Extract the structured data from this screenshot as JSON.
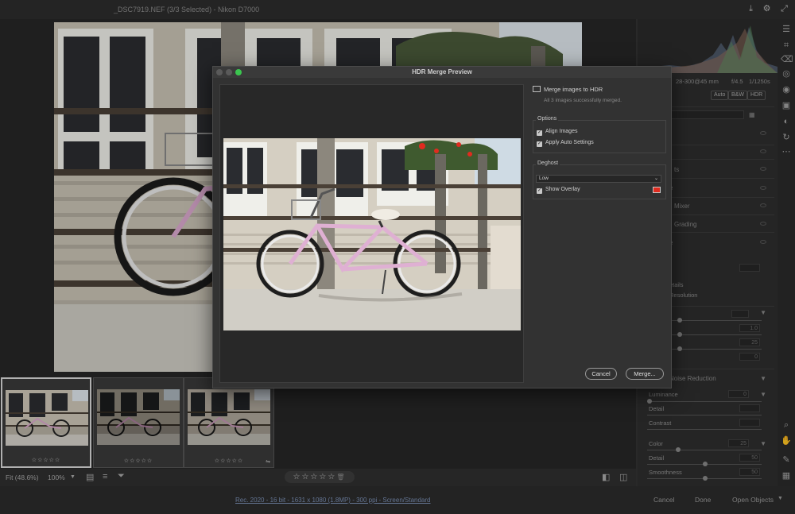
{
  "window": {
    "title": "_DSC7919.NEF (3/3 Selected)  -  Nikon D7000"
  },
  "right_panel": {
    "camera_info": [
      "28-300@45 mm",
      "f/4.5",
      "1/1250s"
    ],
    "profile_buttons": [
      "Auto",
      "B&W",
      "HDR"
    ],
    "sections": [
      "ts",
      "e",
      "Mixer",
      "Grading",
      "e",
      "etails",
      "Resolution",
      "Noise Reduction"
    ],
    "values": [
      "1.0",
      "25",
      "0"
    ],
    "noise": {
      "luminance_label": "Luminance",
      "luminance_value": "0",
      "detail_label": "Detail",
      "contrast_label": "Contrast",
      "color_label": "Color",
      "color_value": "25",
      "color_detail_label": "Detail",
      "color_detail_value": "50",
      "smoothness_label": "Smoothness",
      "smoothness_value": "50"
    }
  },
  "filmstrip": {
    "thumbs": [
      {
        "stars": "☆☆☆☆☆",
        "selected": true
      },
      {
        "stars": "☆☆☆☆☆",
        "selected": false
      },
      {
        "stars": "☆☆☆☆☆",
        "selected": false
      }
    ]
  },
  "bottombar": {
    "fit": "Fit (48.6%)",
    "zoom": "100%",
    "rating": "☆☆☆☆☆"
  },
  "status": {
    "info": "Rec. 2020 - 16 bit - 1631 x 1080 (1.8MP) - 300 ppi - Screen/Standard",
    "cancel": "Cancel",
    "done": "Done",
    "open": "Open Objects"
  },
  "dialog": {
    "title": "HDR Merge Preview",
    "merge_title": "Merge images to HDR",
    "merge_sub": "All 3 images successfully merged.",
    "options_label": "Options",
    "align_images": "Align Images",
    "apply_auto": "Apply Auto Settings",
    "deghost_label": "Deghost",
    "deghost_value": "Low",
    "show_overlay": "Show Overlay",
    "overlay_color": "#e02b1f",
    "cancel": "Cancel",
    "merge": "Merge..."
  }
}
